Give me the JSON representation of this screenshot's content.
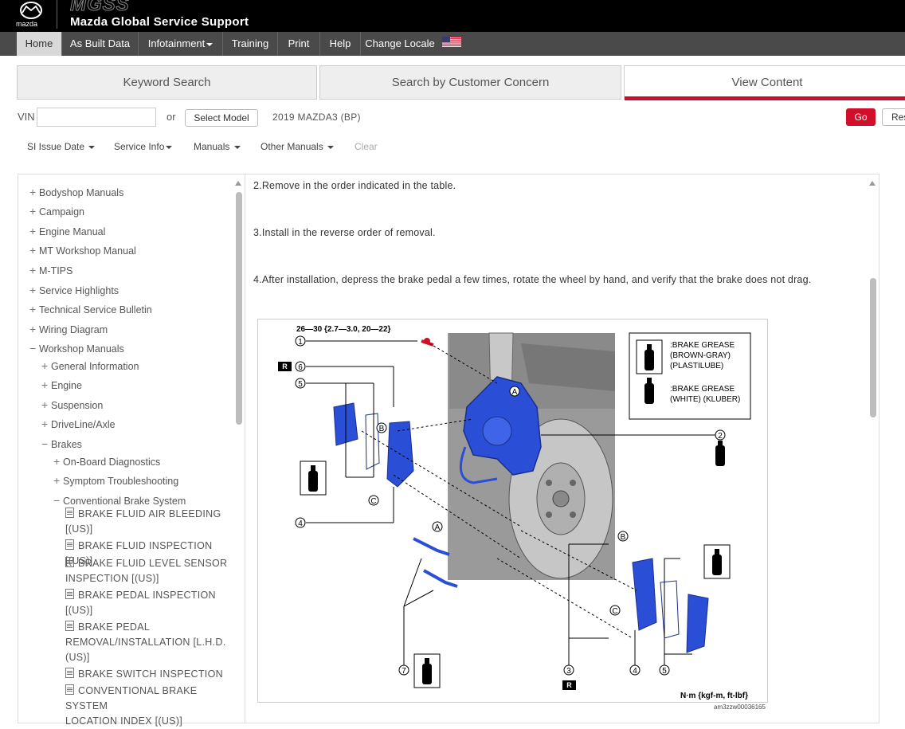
{
  "header": {
    "logo_word": "mazda",
    "brand_mark": "MGSS",
    "title": "Mazda Global Service Support"
  },
  "nav": {
    "home": "Home",
    "as_built": "As Built Data",
    "infotainment": "Infotainment",
    "training": "Training",
    "print": "Print",
    "help": "Help",
    "change_locale": "Change Locale",
    "flag_icon": "us-flag-icon"
  },
  "tabs": {
    "keyword": "Keyword Search",
    "concern": "Search by Customer Concern",
    "view": "View Content",
    "accent": "#c8102e"
  },
  "search": {
    "vin_label": "VIN",
    "vin_value": "",
    "or": "or",
    "select_model": "Select Model",
    "model": "2019 MAZDA3 (BP)",
    "go": "Go",
    "reset": "Res"
  },
  "filters": {
    "si_issue_date": "SI Issue Date",
    "service_info": "Service Info",
    "manuals": "Manuals",
    "other_manuals": "Other Manuals",
    "clear": "Clear"
  },
  "tree": {
    "bodyshop": "Bodyshop Manuals",
    "campaign": "Campaign",
    "engine_manual": "Engine Manual",
    "mt_workshop": "MT Workshop Manual",
    "mtips": "M-TIPS",
    "service_highlights": "Service Highlights",
    "tsb": "Technical Service Bulletin",
    "wiring": "Wiring Diagram",
    "workshop": "Workshop Manuals",
    "general_info": "General Information",
    "engine": "Engine",
    "suspension": "Suspension",
    "driveline": "DriveLine/Axle",
    "brakes": "Brakes",
    "obd": "On-Board Diagnostics",
    "symptom": "Symptom Troubleshooting",
    "conventional": "Conventional Brake System",
    "doc1a": "BRAKE FLUID AIR BLEEDING",
    "doc1b": "[(US)]",
    "doc2": "BRAKE FLUID INSPECTION [(US)]",
    "doc3a": "BRAKE FLUID LEVEL SENSOR",
    "doc3b": "INSPECTION [(US)]",
    "doc4a": "BRAKE PEDAL INSPECTION",
    "doc4b": "[(US)]",
    "doc5a": "BRAKE PEDAL",
    "doc5b": "REMOVAL/INSTALLATION [L.H.D.",
    "doc5c": "(US)]",
    "doc6": "BRAKE SWITCH INSPECTION",
    "doc7a": "CONVENTIONAL BRAKE SYSTEM",
    "doc7b": "LOCATION INDEX [(US)]"
  },
  "content": {
    "step2": "2.Remove in the order indicated in the table.",
    "step3": "3.Install in the reverse order of removal.",
    "step4": "4.After installation, depress the brake pedal a few times, rotate the wheel by hand, and verify that the brake does not drag."
  },
  "figure": {
    "torque": "26—30 {2.7—3.0, 20—22}",
    "legend_grease1_line1": ":BRAKE GREASE",
    "legend_grease1_line2": "(BROWN-GRAY)",
    "legend_grease1_line3": "(PLASTILUBE)",
    "legend_grease2_line1": ":BRAKE GREASE",
    "legend_grease2_line2": "(WHITE) (KLUBER)",
    "units": "N·m {kgf-m, ft-lbf}",
    "figure_id": "am3zzw00036165",
    "callout_1": "1",
    "callout_2": "2",
    "callout_3": "3",
    "callout_4": "4",
    "callout_5": "5",
    "callout_6": "6",
    "callout_7": "7",
    "label_A": "A",
    "label_B": "B",
    "label_C": "C",
    "label_R": "R",
    "part_color": "#2a4fd6"
  }
}
